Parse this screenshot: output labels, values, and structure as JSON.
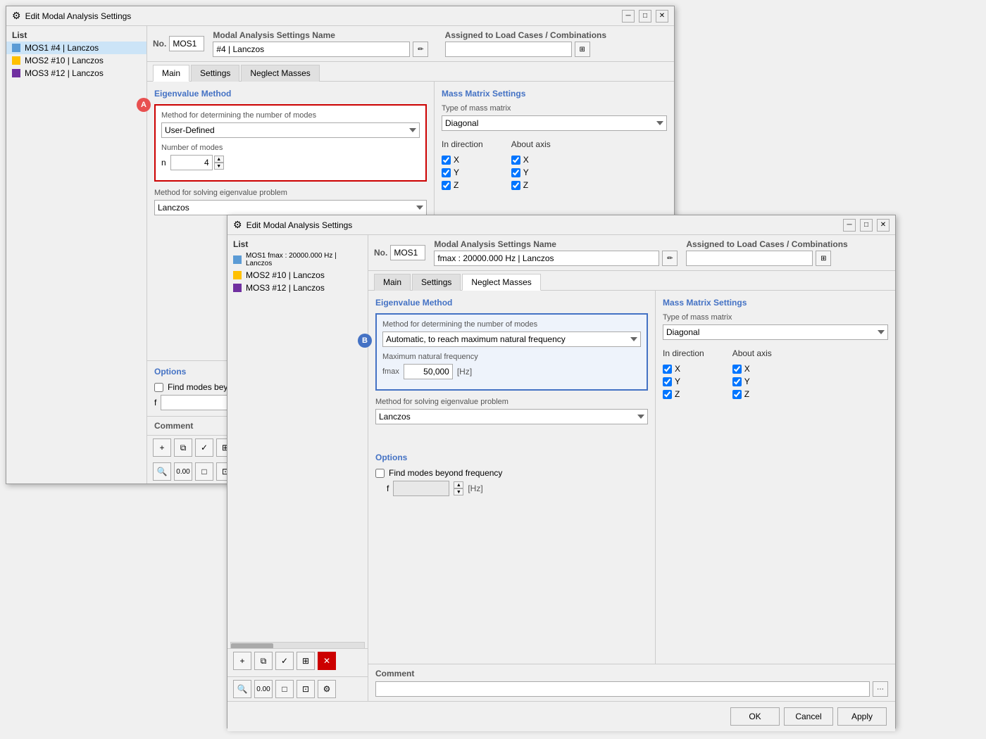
{
  "dialog1": {
    "title": "Edit Modal Analysis Settings",
    "list": {
      "header": "List",
      "items": [
        {
          "id": "MOS1",
          "label": "MOS1  #4 | Lanczos",
          "color": "#5b9bd5",
          "selected": true
        },
        {
          "id": "MOS2",
          "label": "MOS2  #10 | Lanczos",
          "color": "#ffc000"
        },
        {
          "id": "MOS3",
          "label": "MOS3  #12 | Lanczos",
          "color": "#7030a0"
        }
      ]
    },
    "no_label": "No.",
    "no_value": "MOS1",
    "name_label": "Modal Analysis Settings Name",
    "name_value": "#4 | Lanczos",
    "assigned_label": "Assigned to Load Cases / Combinations",
    "tabs": [
      "Main",
      "Settings",
      "Neglect Masses"
    ],
    "active_tab": "Main",
    "eigenvalue_method": {
      "title": "Eigenvalue Method",
      "method_label": "Method for determining the number of modes",
      "method_value": "User-Defined",
      "modes_label": "Number of modes",
      "modes_n_label": "n",
      "modes_value": "4",
      "solving_label": "Method for solving eigenvalue problem",
      "solving_value": "Lanczos"
    },
    "mass_matrix": {
      "title": "Mass Matrix Settings",
      "type_label": "Type of mass matrix",
      "type_value": "Diagonal",
      "in_direction_label": "In direction",
      "about_axis_label": "About axis",
      "checkboxes_direction": [
        "X",
        "Y",
        "Z"
      ],
      "checkboxes_axis": [
        "X",
        "Y",
        "Z"
      ]
    },
    "options": {
      "title": "Options",
      "find_modes_label": "Find modes beyond frequency",
      "find_modes_checked": false,
      "f_label": "f"
    },
    "comment_label": "Comment"
  },
  "dialog2": {
    "title": "Edit Modal Analysis Settings",
    "list": {
      "header": "List",
      "items": [
        {
          "id": "MOS1",
          "label": "MOS1  fmax : 20000.000 Hz | Lanczos",
          "color": "#5b9bd5",
          "selected": false
        },
        {
          "id": "MOS2",
          "label": "MOS2  #10 | Lanczos",
          "color": "#ffc000"
        },
        {
          "id": "MOS3",
          "label": "MOS3  #12 | Lanczos",
          "color": "#7030a0"
        }
      ]
    },
    "no_label": "No.",
    "no_value": "MOS1",
    "name_label": "Modal Analysis Settings Name",
    "name_value": "fmax : 20000.000 Hz | Lanczos",
    "assigned_label": "Assigned to Load Cases / Combinations",
    "tabs": [
      "Main",
      "Settings",
      "Neglect Masses"
    ],
    "active_tab": "Neglect Masses",
    "eigenvalue_method": {
      "title": "Eigenvalue Method",
      "method_label": "Method for determining the number of modes",
      "method_value": "Automatic, to reach maximum natural frequency",
      "max_freq_label": "Maximum natural frequency",
      "fmax_label": "fmax",
      "fmax_value": "50,000",
      "fmax_unit": "[Hz]",
      "solving_label": "Method for solving eigenvalue problem",
      "solving_value": "Lanczos"
    },
    "mass_matrix": {
      "title": "Mass Matrix Settings",
      "type_label": "Type of mass matrix",
      "type_value": "Diagonal",
      "in_direction_label": "In direction",
      "about_axis_label": "About axis",
      "checkboxes_direction": [
        "X",
        "Y",
        "Z"
      ],
      "checkboxes_axis": [
        "X",
        "Y",
        "Z"
      ]
    },
    "options": {
      "title": "Options",
      "find_modes_label": "Find modes beyond frequency",
      "find_modes_checked": false,
      "f_label": "f",
      "hz_unit": "[Hz]"
    },
    "comment_label": "Comment",
    "buttons": {
      "ok": "OK",
      "cancel": "Cancel",
      "apply": "Apply"
    }
  }
}
